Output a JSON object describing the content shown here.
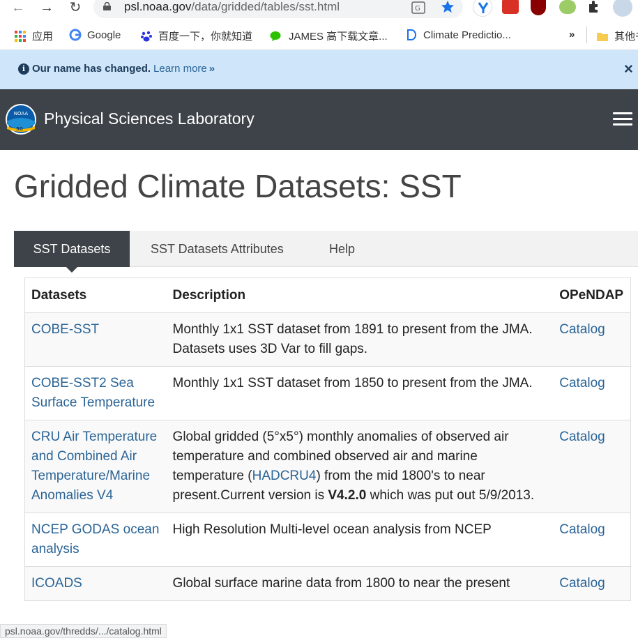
{
  "browser": {
    "url_host": "psl.noaa.gov",
    "url_path": "/data/gridded/tables/sst.html",
    "bookmarks": [
      {
        "label": "应用",
        "icon": "apps-grid-icon"
      },
      {
        "label": "Google",
        "icon": "google-icon"
      },
      {
        "label": "百度一下，你就知道",
        "icon": "baidu-paw-icon"
      },
      {
        "label": "JAMES 高下载文章...",
        "icon": "wechat-icon"
      },
      {
        "label": "Climate Predictio...",
        "icon": "bookmark-d-icon"
      },
      {
        "label": "»",
        "icon": "more-icon"
      },
      {
        "label": "其他书签",
        "icon": "folder-icon"
      }
    ],
    "status_url": "psl.noaa.gov/thredds/.../catalog.html"
  },
  "banner": {
    "bold": "Our name has changed.",
    "link": "Learn more",
    "chevrons": "»",
    "close": "×"
  },
  "header": {
    "logo_text": "NOAA",
    "logo_badge": "50",
    "title": "Physical Sciences Laboratory"
  },
  "page": {
    "title": "Gridded Climate Datasets: SST"
  },
  "tabs": [
    {
      "label": "SST Datasets",
      "active": true
    },
    {
      "label": "SST Datasets Attributes",
      "active": false
    },
    {
      "label": "Help",
      "active": false
    }
  ],
  "table": {
    "headers": [
      "Datasets",
      "Description",
      "OPeNDAP"
    ],
    "rows": [
      {
        "name": "COBE-SST",
        "desc": "Monthly 1x1 SST dataset from 1891 to present from the JMA. Datasets uses 3D Var to fill gaps.",
        "opendap": "Catalog"
      },
      {
        "name": "COBE-SST2 Sea Surface Temperature",
        "desc": "Monthly 1x1 SST dataset from 1850 to present from the JMA.",
        "opendap": "Catalog"
      },
      {
        "name": "CRU Air Temperature and Combined Air Temperature/Marine Anomalies V4",
        "desc_a": "Global gridded (5°x5°) monthly anomalies of observed air temperature and combined observed air and marine temperature (",
        "desc_link": "HADCRU4",
        "desc_b": ") from the mid 1800's to near present.Current version is ",
        "desc_bold": "V4.2.0",
        "desc_c": " which was put out 5/9/2013.",
        "opendap": "Catalog"
      },
      {
        "name": "NCEP GODAS ocean analysis",
        "desc": "High Resolution Multi-level ocean analysis from NCEP",
        "opendap": "Catalog"
      },
      {
        "name": "ICOADS",
        "desc": "Global surface marine data from 1800 to near the present",
        "opendap": "Catalog"
      }
    ]
  }
}
